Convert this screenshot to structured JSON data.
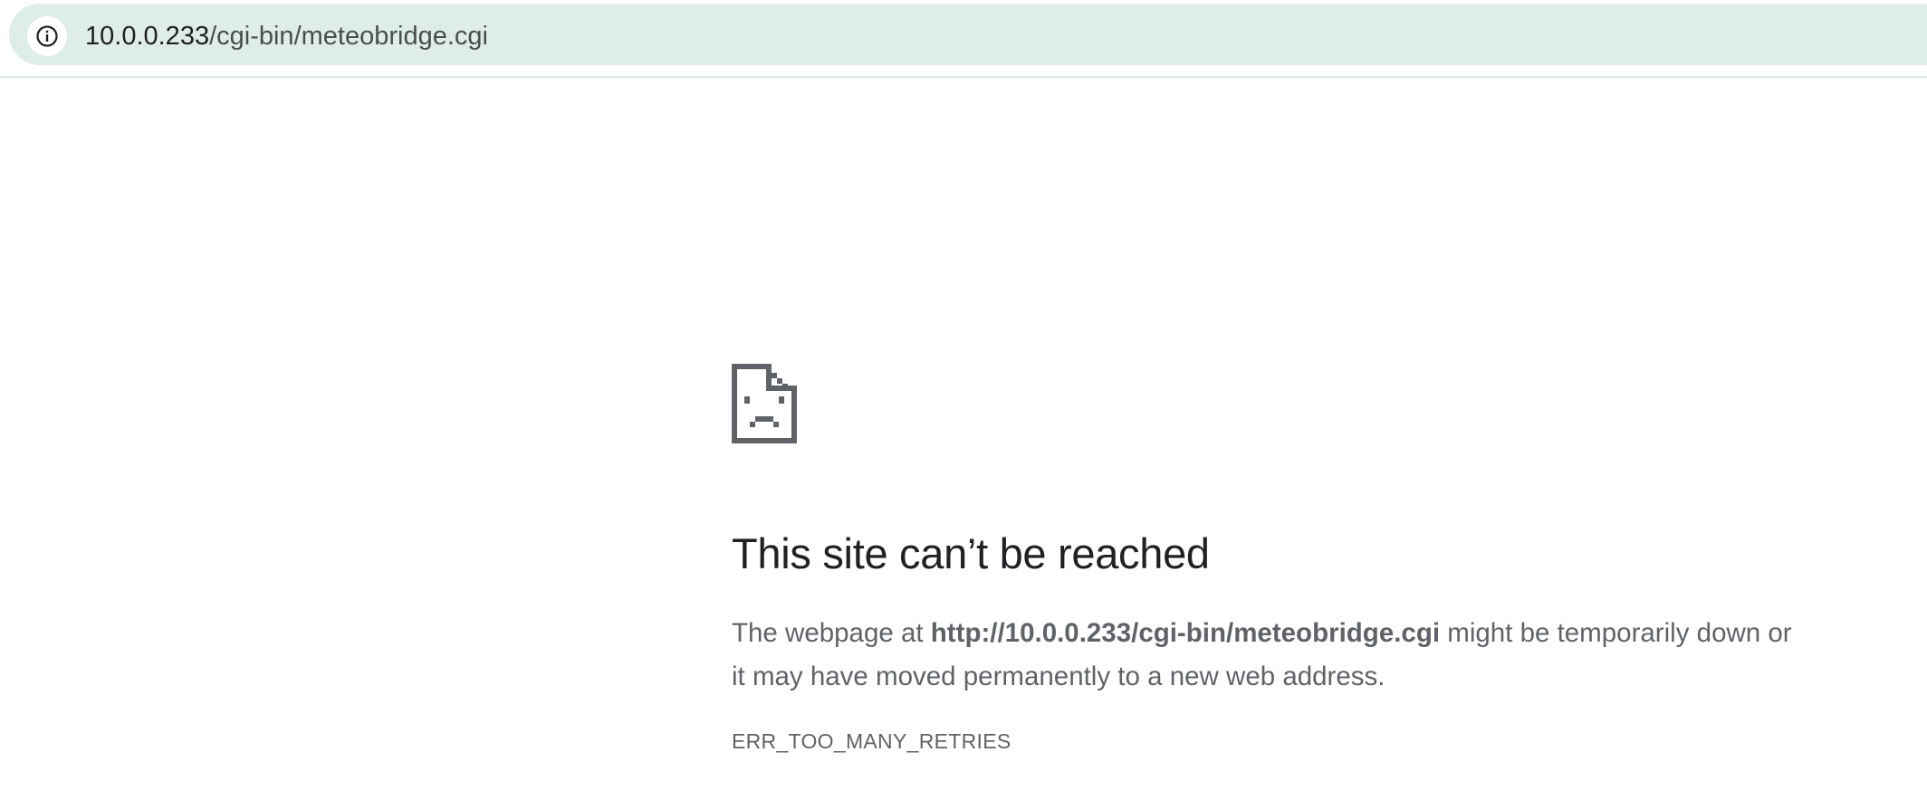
{
  "address_bar": {
    "site_info_icon": "info-circle-icon",
    "url_host": "10.0.0.233",
    "url_path": "/cgi-bin/meteobridge.cgi"
  },
  "error_page": {
    "icon": "sad-document-icon",
    "heading": "This site can’t be reached",
    "message_prefix": "The webpage at ",
    "message_url": "http://10.0.0.233/cgi-bin/meteobridge.cgi",
    "message_suffix": " might be temporarily down or it may have moved permanently to a new web address.",
    "error_code": "ERR_TOO_MANY_RETRIES"
  },
  "colors": {
    "omnibox_background": "#deede8",
    "heading_text": "#202124",
    "body_text": "#5f6368"
  }
}
